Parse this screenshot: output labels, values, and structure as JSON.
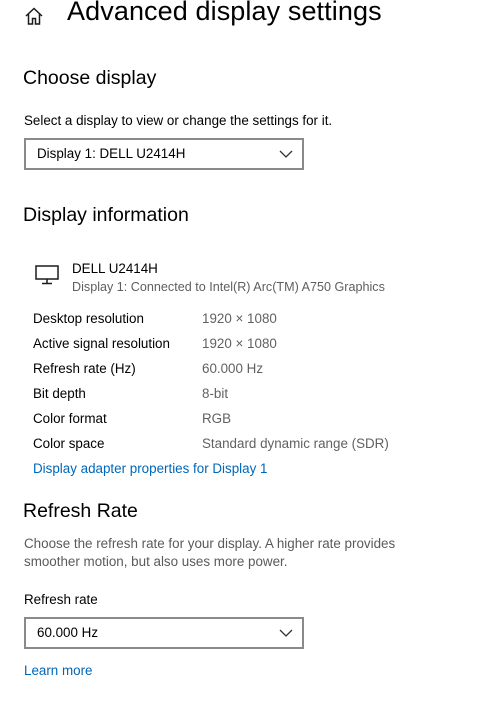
{
  "header": {
    "title": "Advanced display settings",
    "home_icon": "home-icon"
  },
  "choose_display": {
    "heading": "Choose display",
    "description": "Select a display to view or change the settings for it.",
    "selected_display": "Display 1: DELL U2414H"
  },
  "display_information": {
    "heading": "Display information",
    "monitor_icon": "monitor-icon",
    "display_name": "DELL U2414H",
    "connection": "Display 1: Connected to Intel(R) Arc(TM) A750 Graphics",
    "rows": [
      {
        "label": "Desktop resolution",
        "value": "1920 × 1080"
      },
      {
        "label": "Active signal resolution",
        "value": "1920 × 1080"
      },
      {
        "label": "Refresh rate (Hz)",
        "value": "60.000 Hz"
      },
      {
        "label": "Bit depth",
        "value": "8-bit"
      },
      {
        "label": "Color format",
        "value": "RGB"
      },
      {
        "label": "Color space",
        "value": "Standard dynamic range (SDR)"
      }
    ],
    "adapter_link": "Display adapter properties for Display 1",
    "link_color": "#0067b8"
  },
  "refresh_rate": {
    "heading": "Refresh Rate",
    "description": "Choose the refresh rate for your display. A higher rate provides smoother motion, but also uses more power.",
    "field_label": "Refresh rate",
    "selected_rate": "60.000 Hz",
    "learn_more": "Learn more"
  }
}
